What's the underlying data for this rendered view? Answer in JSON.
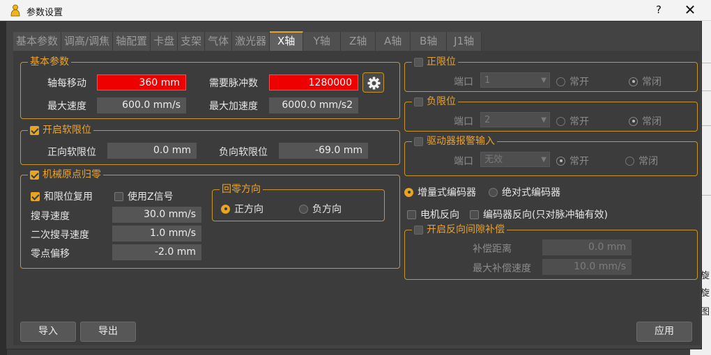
{
  "window": {
    "title": "参数设置",
    "help": "?",
    "close": "✕"
  },
  "tabs": [
    {
      "label": "基本参数"
    },
    {
      "label": "调高/调焦"
    },
    {
      "label": "轴配置"
    },
    {
      "label": "卡盘"
    },
    {
      "label": "支架"
    },
    {
      "label": "气体"
    },
    {
      "label": "激光器"
    },
    {
      "label": "X轴"
    },
    {
      "label": "Y轴"
    },
    {
      "label": "Z轴"
    },
    {
      "label": "A轴"
    },
    {
      "label": "B轴"
    },
    {
      "label": "J1轴"
    }
  ],
  "active_tab": "X轴",
  "basic": {
    "title": "基本参数",
    "move_per_rev_label": "轴每移动",
    "move_per_rev": "360 mm",
    "pulses_label": "需要脉冲数",
    "pulses": "1280000",
    "max_speed_label": "最大速度",
    "max_speed": "600.0 mm/s",
    "max_accel_label": "最大加速度",
    "max_accel": "6000.0 mm/s2"
  },
  "softlimit": {
    "title": "开启软限位",
    "checked": true,
    "pos_label": "正向软限位",
    "pos": "0.0 mm",
    "neg_label": "负向软限位",
    "neg": "-69.0 mm"
  },
  "homing": {
    "title": "机械原点归零",
    "checked": true,
    "reuse_limit": "和限位复用",
    "use_z": "使用Z信号",
    "search_speed_label": "搜寻速度",
    "search_speed": "30.0 mm/s",
    "second_speed_label": "二次搜寻速度",
    "second_speed": "1.0 mm/s",
    "offset_label": "零点偏移",
    "offset": "-2.0 mm",
    "direction": {
      "title": "回零方向",
      "positive": "正方向",
      "negative": "负方向"
    }
  },
  "pos_limit": {
    "title": "正限位",
    "port_label": "端口",
    "port": "1",
    "no": "常开",
    "nc": "常闭"
  },
  "neg_limit": {
    "title": "负限位",
    "port_label": "端口",
    "port": "2",
    "no": "常开",
    "nc": "常闭"
  },
  "driver_alarm": {
    "title": "驱动器报警输入",
    "port_label": "端口",
    "port": "无效",
    "no": "常开",
    "nc": "常闭"
  },
  "encoder": {
    "incremental": "增量式编码器",
    "absolute": "绝对式编码器",
    "motor_reverse": "电机反向",
    "encoder_reverse": "编码器反向(只对脉冲轴有效)"
  },
  "backlash": {
    "title": "开启反向间隙补偿",
    "distance_label": "补偿距离",
    "distance": "0.0 mm",
    "speed_label": "最大补偿速度",
    "speed": "10.0 mm/s"
  },
  "buttons": {
    "import": "导入",
    "export": "导出",
    "apply": "应用"
  },
  "background_app": {
    "chars": [
      "旋",
      "旋",
      "图"
    ]
  },
  "colors": {
    "accent": "#e7a425",
    "highlight_field": "#ee0000",
    "panel": "#3c3c3c"
  }
}
